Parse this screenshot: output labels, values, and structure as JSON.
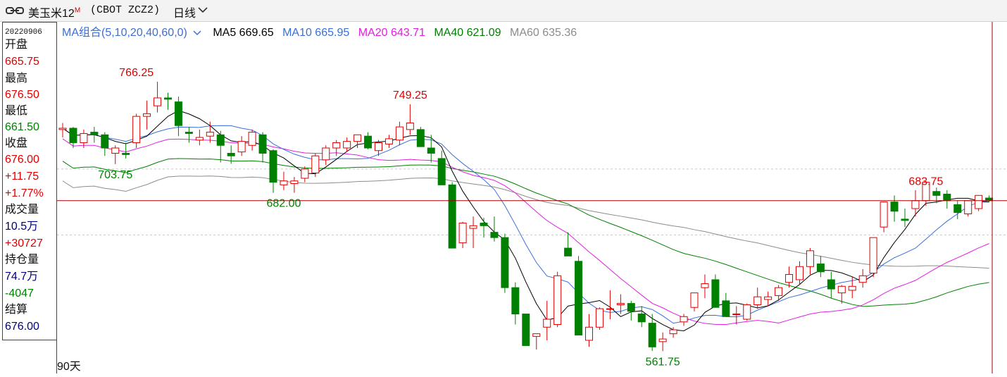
{
  "titlebar": {
    "name": "美玉米12",
    "badge": "M",
    "code": "(CBOT ZCZ2)",
    "period": "日线"
  },
  "panel": {
    "date": "20220906",
    "open_label": "开盘",
    "open": "665.75",
    "high_label": "最高",
    "high": "676.50",
    "low_label": "最低",
    "low": "661.50",
    "close_label": "收盘",
    "close": "676.00",
    "change": "+11.75",
    "change_pct": "+1.77%",
    "volume_label": "成交量",
    "volume": "10.5万",
    "volume_change": "+30727",
    "oi_label": "持仓量",
    "oi": "74.7万",
    "oi_change": "-4047",
    "settle_label": "结算",
    "settle": "676.00"
  },
  "legend": {
    "group": "MA组合(5,10,20,40,60,0)",
    "ma5": "MA5 669.65",
    "ma10": "MA10 665.95",
    "ma20": "MA20 643.71",
    "ma40": "MA40 621.09",
    "ma60": "MA60 635.36"
  },
  "footer": {
    "days": "90天"
  },
  "colors": {
    "up": "#e00000",
    "down": "#008000",
    "ma5": "#000000",
    "ma10": "#3a6fd8",
    "ma20": "#e020e0",
    "ma40": "#008000",
    "ma60": "#8c8c8c",
    "crosshair": "#a00000",
    "grid": "#c8c8c8"
  },
  "chart_data": {
    "type": "candlestick",
    "ylim": [
      555,
      785
    ],
    "price_annotations": [
      {
        "index": 7,
        "value": 766.25,
        "kind": "high"
      },
      {
        "index": 5,
        "value": 703.75,
        "kind": "low"
      },
      {
        "index": 21,
        "value": 682.0,
        "kind": "low"
      },
      {
        "index": 33,
        "value": 749.25,
        "kind": "high"
      },
      {
        "index": 57,
        "value": 561.75,
        "kind": "low"
      },
      {
        "index": 82,
        "value": 683.75,
        "kind": "high"
      }
    ],
    "crosshair_price": 676.0,
    "candles": [
      [
        730,
        735,
        724,
        731
      ],
      [
        731,
        732,
        716,
        720
      ],
      [
        720,
        730,
        716,
        727
      ],
      [
        728,
        732,
        720,
        726
      ],
      [
        726,
        728,
        710,
        716
      ],
      [
        712,
        718,
        703.75,
        716
      ],
      [
        712,
        720,
        708,
        711
      ],
      [
        720,
        742,
        716,
        740
      ],
      [
        740,
        752,
        730,
        742
      ],
      [
        748,
        766.25,
        743,
        754
      ],
      [
        754,
        758,
        745,
        753
      ],
      [
        751,
        755,
        725,
        733
      ],
      [
        728,
        732,
        720,
        727
      ],
      [
        722,
        730,
        718,
        724
      ],
      [
        725,
        736,
        720,
        728
      ],
      [
        726,
        729,
        705,
        718
      ],
      [
        712,
        718,
        704,
        710
      ],
      [
        713,
        725,
        710,
        721
      ],
      [
        718,
        730,
        714,
        728
      ],
      [
        726,
        728,
        705,
        712
      ],
      [
        714,
        715,
        682,
        690
      ],
      [
        688,
        698,
        684,
        691
      ],
      [
        689,
        694,
        682,
        691
      ],
      [
        693,
        702,
        690,
        700
      ],
      [
        697,
        712,
        694,
        710
      ],
      [
        707,
        718,
        703,
        716
      ],
      [
        716,
        722,
        710,
        720
      ],
      [
        716,
        724,
        713,
        721
      ],
      [
        721,
        726,
        716,
        726
      ],
      [
        725,
        728,
        715,
        716
      ],
      [
        714,
        722,
        710,
        720
      ],
      [
        719,
        726,
        716,
        723
      ],
      [
        722,
        736,
        718,
        732
      ],
      [
        730,
        749.25,
        726,
        735
      ],
      [
        730,
        732,
        718,
        717
      ],
      [
        716,
        726,
        705,
        712
      ],
      [
        708,
        714,
        690,
        688
      ],
      [
        688,
        690,
        642,
        640
      ],
      [
        644,
        660,
        640,
        659
      ],
      [
        655,
        664,
        640,
        657
      ],
      [
        659,
        663,
        648,
        657
      ],
      [
        652,
        664,
        645,
        648
      ],
      [
        648,
        651,
        606,
        610
      ],
      [
        610,
        614,
        582,
        590
      ],
      [
        590,
        590,
        567,
        566
      ],
      [
        573,
        575,
        563,
        575
      ],
      [
        580,
        600,
        570,
        586
      ],
      [
        582,
        622,
        580,
        619
      ],
      [
        640,
        652,
        636,
        634
      ],
      [
        630,
        634,
        578,
        574
      ],
      [
        570,
        590,
        565,
        580
      ],
      [
        580,
        595,
        578,
        594
      ],
      [
        594,
        608,
        586,
        594
      ],
      [
        597,
        605,
        590,
        598
      ],
      [
        598,
        600,
        585,
        592
      ],
      [
        590,
        596,
        580,
        584
      ],
      [
        583,
        590,
        562,
        565
      ],
      [
        569,
        576,
        561.75,
        571
      ],
      [
        575,
        580,
        572,
        578
      ],
      [
        584,
        590,
        581,
        588
      ],
      [
        595,
        605,
        592,
        606
      ],
      [
        610,
        620,
        602,
        613
      ],
      [
        616,
        620,
        600,
        595
      ],
      [
        600,
        606,
        590,
        588
      ],
      [
        590,
        596,
        582,
        590
      ],
      [
        586,
        598,
        585,
        597
      ],
      [
        597,
        610,
        594,
        603
      ],
      [
        601,
        607,
        596,
        603
      ],
      [
        604,
        612,
        600,
        610
      ],
      [
        614,
        626,
        610,
        620
      ],
      [
        616,
        630,
        612,
        626
      ],
      [
        626,
        640,
        620,
        638
      ],
      [
        628,
        634,
        618,
        622
      ],
      [
        616,
        622,
        602,
        609
      ],
      [
        606,
        612,
        598,
        611
      ],
      [
        608,
        618,
        602,
        611
      ],
      [
        614,
        624,
        610,
        619
      ],
      [
        621,
        645,
        618,
        648
      ],
      [
        656,
        668,
        652,
        675
      ],
      [
        675,
        680,
        660,
        668
      ],
      [
        662,
        670,
        656,
        661
      ],
      [
        670,
        684,
        664,
        676
      ],
      [
        676,
        683.75,
        672,
        690
      ],
      [
        683,
        686,
        674,
        680
      ],
      [
        681,
        684,
        670,
        676
      ],
      [
        673,
        676,
        662,
        667
      ],
      [
        666,
        676,
        664,
        676
      ],
      [
        670,
        680,
        668,
        680
      ],
      [
        678,
        680,
        675,
        676
      ]
    ]
  }
}
